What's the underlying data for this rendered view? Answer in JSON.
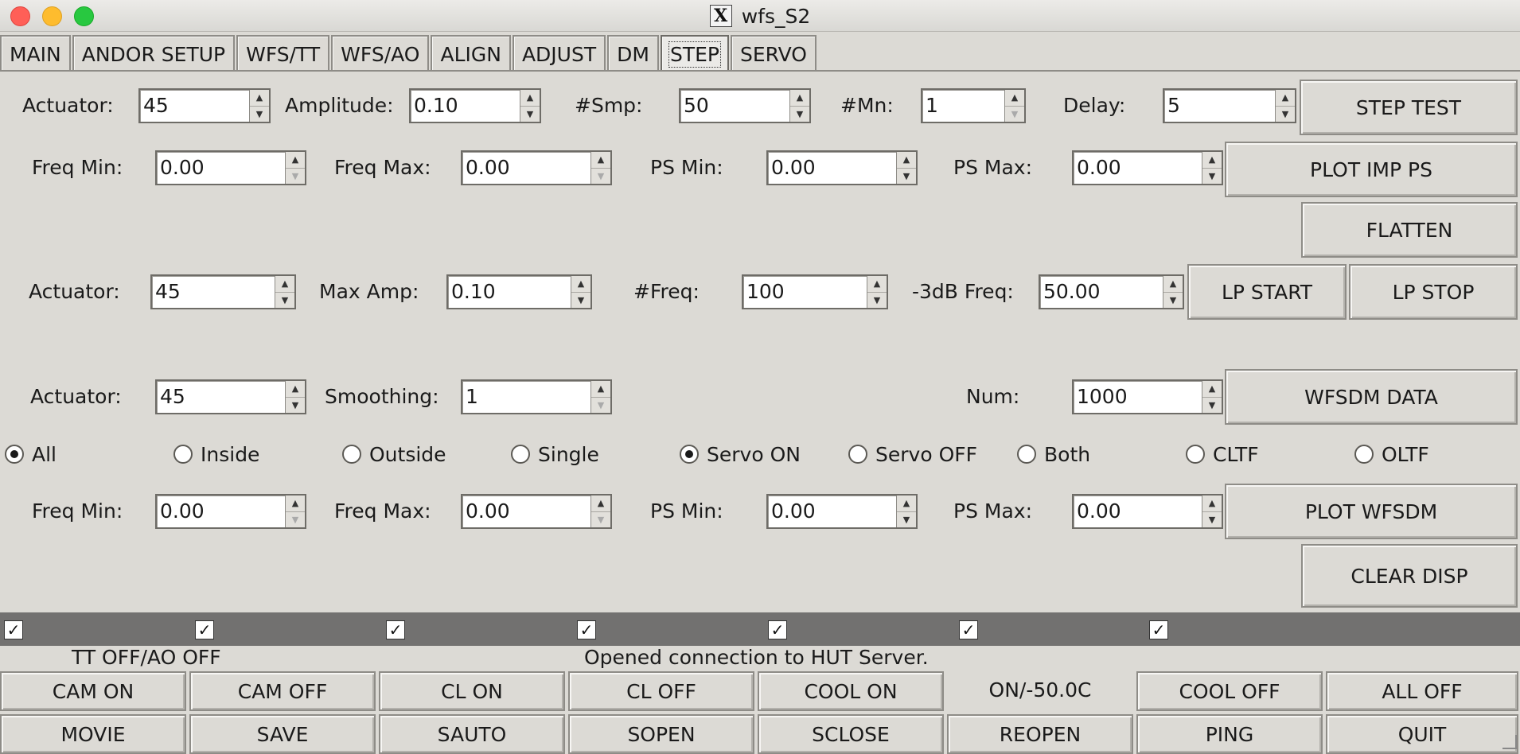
{
  "window": {
    "title": "wfs_S2"
  },
  "tabs": [
    "MAIN",
    "ANDOR SETUP",
    "WFS/TT",
    "WFS/AO",
    "ALIGN",
    "ADJUST",
    "DM",
    "STEP",
    "SERVO"
  ],
  "active_tab": "STEP",
  "step_row": {
    "actuator_label": "Actuator:",
    "actuator": "45",
    "amplitude_label": "Amplitude:",
    "amplitude": "0.10",
    "smp_label": "#Smp:",
    "smp": "50",
    "mn_label": "#Mn:",
    "mn": "1",
    "delay_label": "Delay:",
    "delay": "5",
    "button": "STEP TEST"
  },
  "imp_ps_row": {
    "freq_min_label": "Freq Min:",
    "freq_min": "0.00",
    "freq_max_label": "Freq Max:",
    "freq_max": "0.00",
    "ps_min_label": "PS Min:",
    "ps_min": "0.00",
    "ps_max_label": "PS Max:",
    "ps_max": "0.00",
    "button": "PLOT IMP PS"
  },
  "flatten_button": "FLATTEN",
  "lp_row": {
    "actuator_label": "Actuator:",
    "actuator": "45",
    "max_amp_label": "Max Amp:",
    "max_amp": "0.10",
    "freq_count_label": "#Freq:",
    "freq_count": "100",
    "db_freq_label": "-3dB Freq:",
    "db_freq": "50.00",
    "start_button": "LP START",
    "stop_button": "LP STOP"
  },
  "wfsdm_row": {
    "actuator_label": "Actuator:",
    "actuator": "45",
    "smoothing_label": "Smoothing:",
    "smoothing": "1",
    "num_label": "Num:",
    "num": "1000",
    "button": "WFSDM DATA"
  },
  "radio_groups": {
    "region": {
      "options": [
        "All",
        "Inside",
        "Outside",
        "Single"
      ],
      "selected": "All"
    },
    "servo": {
      "options": [
        "Servo ON",
        "Servo OFF",
        "Both"
      ],
      "selected": "Servo ON"
    },
    "tf": {
      "options": [
        "CLTF",
        "OLTF"
      ],
      "selected": ""
    }
  },
  "wfsdm_plot_row": {
    "freq_min_label": "Freq Min:",
    "freq_min": "0.00",
    "freq_max_label": "Freq Max:",
    "freq_max": "0.00",
    "ps_min_label": "PS Min:",
    "ps_min": "0.00",
    "ps_max_label": "PS Max:",
    "ps_max": "0.00",
    "button": "PLOT WFSDM"
  },
  "clear_disp_button": "CLEAR DISP",
  "checkmark": "✓",
  "status": {
    "left": "TT OFF/AO OFF",
    "center": "Opened connection to HUT Server."
  },
  "bottom_row1": [
    "CAM ON",
    "CAM OFF",
    "CL ON",
    "CL OFF",
    "COOL ON",
    "ON/-50.0C",
    "COOL OFF",
    "ALL OFF"
  ],
  "bottom_row2": [
    "MOVIE",
    "SAVE",
    "SAUTO",
    "SOPEN",
    "SCLOSE",
    "REOPEN",
    "PING",
    "QUIT"
  ],
  "colors": {
    "window_bg": "#dcdad5",
    "strip_bg": "#727170",
    "close": "#ff5f57",
    "minimize": "#febc2e",
    "maximize": "#28c840"
  }
}
